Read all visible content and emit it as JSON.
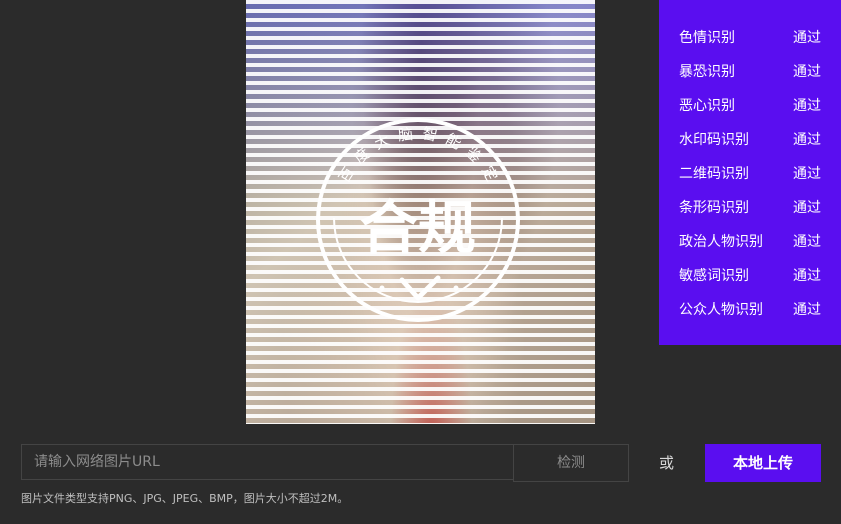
{
  "results": [
    {
      "label": "色情识别",
      "status": "通过"
    },
    {
      "label": "暴恐识别",
      "status": "通过"
    },
    {
      "label": "恶心识别",
      "status": "通过"
    },
    {
      "label": "水印码识别",
      "status": "通过"
    },
    {
      "label": "二维码识别",
      "status": "通过"
    },
    {
      "label": "条形码识别",
      "status": "通过"
    },
    {
      "label": "政治人物识别",
      "status": "通过"
    },
    {
      "label": "敏感词识别",
      "status": "通过"
    },
    {
      "label": "公众人物识别",
      "status": "通过"
    }
  ],
  "stamp": {
    "arc_text": "百度大脑智能鉴定",
    "main_text": "合规"
  },
  "input": {
    "placeholder": "请输入网络图片URL",
    "value": ""
  },
  "buttons": {
    "detect": "检测",
    "upload": "本地上传"
  },
  "or_label": "或",
  "hint": "图片文件类型支持PNG、JPG、JPEG、BMP，图片大小不超过2M。",
  "colors": {
    "accent": "#5a0ef0",
    "background": "#2b2b2b"
  }
}
